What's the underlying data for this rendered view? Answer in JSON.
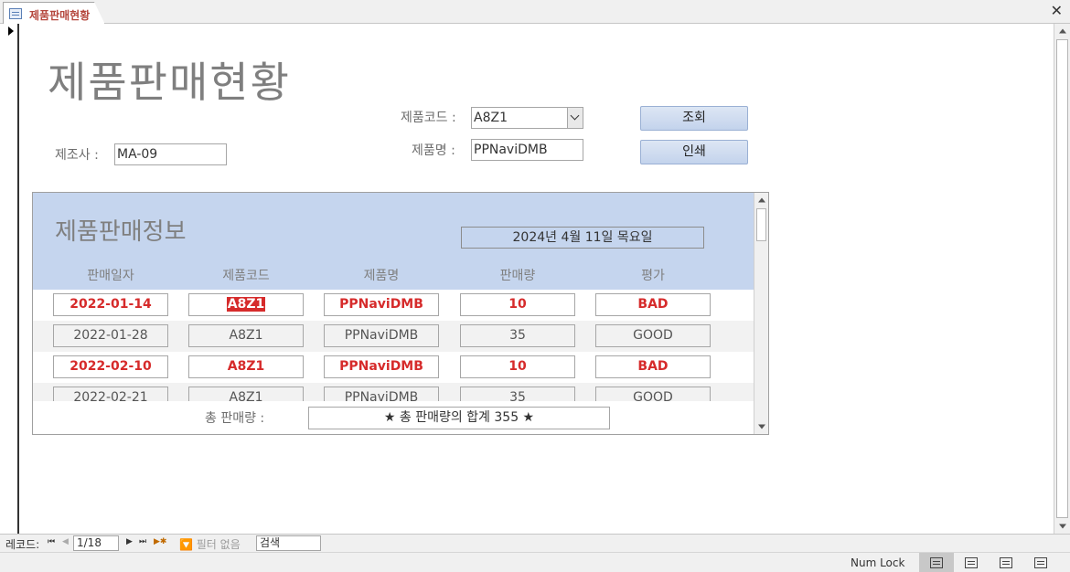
{
  "tab": {
    "label": "제품판매현황",
    "close": "✕"
  },
  "form": {
    "title": "제품판매현황",
    "product_code_label": "제품코드 :",
    "product_code_value": "A8Z1",
    "product_name_label": "제품명 :",
    "product_name_value": "PPNaviDMB",
    "maker_label": "제조사 :",
    "maker_value": "MA-09",
    "search_button": "조회",
    "print_button": "인쇄"
  },
  "subform": {
    "title": "제품판매정보",
    "date": "2024년 4월 11일 목요일",
    "columns": [
      "판매일자",
      "제품코드",
      "제품명",
      "판매량",
      "평가"
    ],
    "rows": [
      {
        "date": "2022-01-14",
        "code": "A8Z1",
        "name": "PPNaviDMB",
        "qty": "10",
        "grade": "BAD"
      },
      {
        "date": "2022-01-28",
        "code": "A8Z1",
        "name": "PPNaviDMB",
        "qty": "35",
        "grade": "GOOD"
      },
      {
        "date": "2022-02-10",
        "code": "A8Z1",
        "name": "PPNaviDMB",
        "qty": "10",
        "grade": "BAD"
      },
      {
        "date": "2022-02-21",
        "code": "A8Z1",
        "name": "PPNaviDMB",
        "qty": "35",
        "grade": "GOOD"
      }
    ],
    "total_label": "총 판매량 :",
    "total_value": "★ 총 판매량의 합계 355 ★"
  },
  "navbar": {
    "label": "레코드:",
    "first": "⏮",
    "prev": "◀",
    "current": "1/18",
    "next": "▶",
    "last": "⏭",
    "new": "▶✱",
    "filter": "🔽 필터 없음",
    "search": "검색"
  },
  "statusbar": {
    "numlock": "Num Lock"
  },
  "colors": {
    "header_bg": "#c5d5ee",
    "bad_text": "#d62b2b",
    "title_gray": "#7f7f7f"
  }
}
